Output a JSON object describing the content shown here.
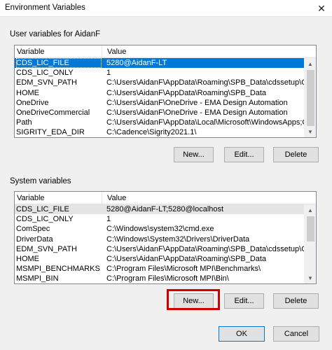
{
  "window": {
    "title": "Environment Variables",
    "close_glyph": "✕"
  },
  "user_vars": {
    "group_label": "User variables for AidanF",
    "headers": {
      "variable": "Variable",
      "value": "Value"
    },
    "rows": [
      {
        "name": "CDS_LIC_FILE",
        "value": "5280@AidanF-LT"
      },
      {
        "name": "CDS_LIC_ONLY",
        "value": "1"
      },
      {
        "name": "EDM_SVN_PATH",
        "value": "C:\\Users\\AidanF\\AppData\\Roaming\\SPB_Data\\cdssetup\\OrCAD_Ca..."
      },
      {
        "name": "HOME",
        "value": "C:\\Users\\AidanF\\AppData\\Roaming\\SPB_Data"
      },
      {
        "name": "OneDrive",
        "value": "C:\\Users\\AidanF\\OneDrive - EMA Design Automation"
      },
      {
        "name": "OneDriveCommercial",
        "value": "C:\\Users\\AidanF\\OneDrive - EMA Design Automation"
      },
      {
        "name": "Path",
        "value": "C:\\Users\\AidanF\\AppData\\Local\\Microsoft\\WindowsApps;C:\\Progr..."
      },
      {
        "name": "SIGRITY_EDA_DIR",
        "value": "C:\\Cadence\\Sigrity2021.1\\"
      }
    ],
    "buttons": {
      "new": "New...",
      "edit": "Edit...",
      "delete": "Delete"
    }
  },
  "system_vars": {
    "group_label": "System variables",
    "headers": {
      "variable": "Variable",
      "value": "Value"
    },
    "rows": [
      {
        "name": "CDS_LIC_FILE",
        "value": "5280@AidanF-LT;5280@localhost"
      },
      {
        "name": "CDS_LIC_ONLY",
        "value": "1"
      },
      {
        "name": "ComSpec",
        "value": "C:\\Windows\\system32\\cmd.exe"
      },
      {
        "name": "DriverData",
        "value": "C:\\Windows\\System32\\Drivers\\DriverData"
      },
      {
        "name": "EDM_SVN_PATH",
        "value": "C:\\Users\\AidanF\\AppData\\Roaming\\SPB_Data\\cdssetup\\OrCAD_Ca..."
      },
      {
        "name": "HOME",
        "value": "C:\\Users\\AidanF\\AppData\\Roaming\\SPB_Data"
      },
      {
        "name": "MSMPI_BENCHMARKS",
        "value": "C:\\Program Files\\Microsoft MPI\\Benchmarks\\"
      },
      {
        "name": "MSMPI_BIN",
        "value": "C:\\Program Files\\Microsoft MPI\\Bin\\"
      }
    ],
    "buttons": {
      "new": "New...",
      "edit": "Edit...",
      "delete": "Delete"
    }
  },
  "footer": {
    "ok": "OK",
    "cancel": "Cancel"
  },
  "icons": {
    "scroll_up": "▲",
    "scroll_down": "▼"
  },
  "colors": {
    "selection": "#0078d7",
    "highlight_box": "#d10000"
  }
}
